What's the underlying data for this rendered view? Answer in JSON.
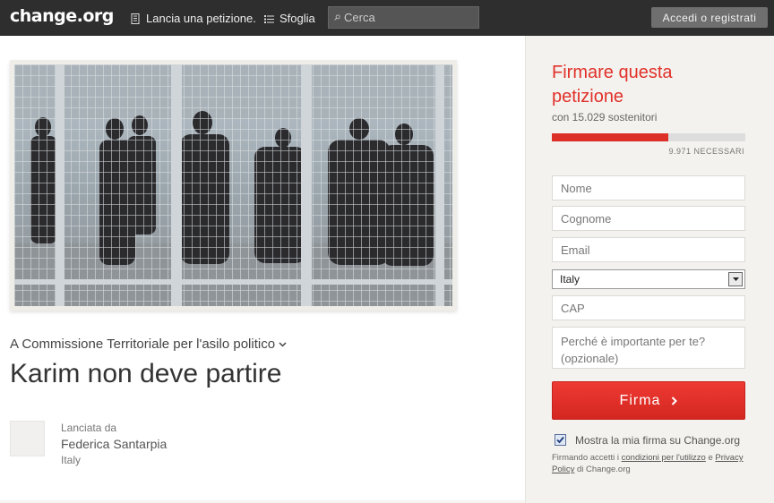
{
  "header": {
    "logo": "change.org",
    "start_petition": "Lancia una petizione.",
    "browse": "Sfoglia",
    "search_placeholder": "Cerca",
    "login": "Accedi o registrati"
  },
  "petition": {
    "target": "A Commissione Territoriale per l'asilo politico",
    "title": "Karim non deve partire",
    "launched_label": "Lanciata da",
    "author": "Federica Santarpia",
    "author_country": "Italy"
  },
  "sign_panel": {
    "title": "Firmare questa petizione",
    "supporters": "con 15.029 sostenitori",
    "progress_fraction": 0.6,
    "needed": "9.971 NECESSARI",
    "first_name_placeholder": "Nome",
    "last_name_placeholder": "Cognome",
    "email_placeholder": "Email",
    "country_selected": "Italy",
    "zip_placeholder": "CAP",
    "reason_placeholder": "Perché è importante per te? (opzionale)",
    "sign_button": "Firma",
    "show_signature_label": "Mostra la mia firma su Change.org",
    "terms_prefix": "Firmando accetti i ",
    "terms_link": "condizioni per l'utilizzo",
    "terms_and": " e ",
    "privacy_link": "Privacy Policy",
    "terms_suffix": " di Change.org"
  },
  "colors": {
    "accent": "#e0312a",
    "topbar": "#2e2e2e"
  }
}
